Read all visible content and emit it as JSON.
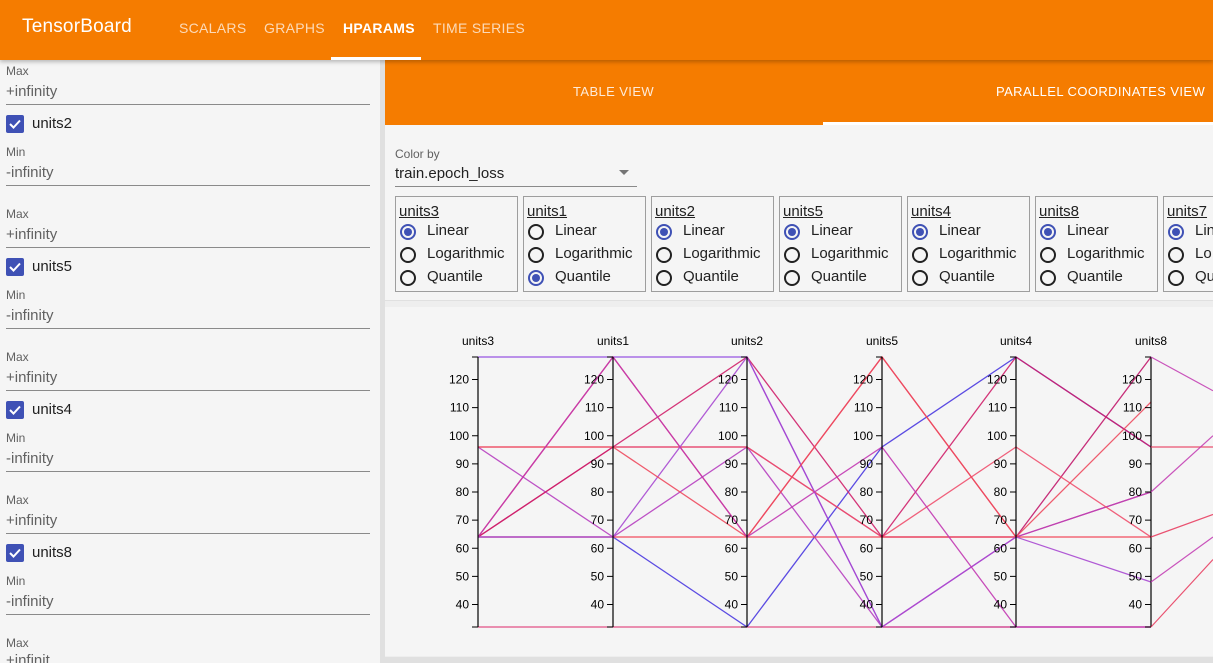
{
  "header": {
    "brand": "TensorBoard",
    "tabs": [
      {
        "label": "SCALARS",
        "active": false
      },
      {
        "label": "GRAPHS",
        "active": false
      },
      {
        "label": "HPARAMS",
        "active": true
      },
      {
        "label": "TIME SERIES",
        "active": false
      }
    ],
    "color": "#f57c00"
  },
  "sidebar": {
    "top_max": {
      "label": "Max",
      "value": "+infinity"
    },
    "filters": [
      {
        "name": "units2",
        "checked": true,
        "min_label": "Min",
        "min_value": "-infinity",
        "max_label": "Max",
        "max_value": "+infinity"
      },
      {
        "name": "units5",
        "checked": true,
        "min_label": "Min",
        "min_value": "-infinity",
        "max_label": "Max",
        "max_value": "+infinity"
      },
      {
        "name": "units4",
        "checked": true,
        "min_label": "Min",
        "min_value": "-infinity",
        "max_label": "Max",
        "max_value": "+infinity"
      },
      {
        "name": "units8",
        "checked": true,
        "min_label": "Min",
        "min_value": "-infinity",
        "max_label": "Max",
        "max_value": "+infinit"
      }
    ]
  },
  "views": {
    "table_label": "TABLE VIEW",
    "parallel_label": "PARALLEL COORDINATES VIEW",
    "active": "parallel"
  },
  "options": {
    "color_by_label": "Color by",
    "color_by_value": "train.epoch_loss",
    "scale_options": [
      "Linear",
      "Logarithmic",
      "Quantile"
    ],
    "scale_options_clipped": [
      "Lin",
      "Lo",
      "Qu"
    ],
    "scales": [
      {
        "name": "units3",
        "selected": "Linear"
      },
      {
        "name": "units1",
        "selected": "Quantile"
      },
      {
        "name": "units2",
        "selected": "Linear"
      },
      {
        "name": "units5",
        "selected": "Linear"
      },
      {
        "name": "units4",
        "selected": "Linear"
      },
      {
        "name": "units8",
        "selected": "Linear"
      },
      {
        "name": "units7",
        "selected": "Linear"
      }
    ]
  },
  "chart_data": {
    "type": "parallel_coordinates",
    "axes": [
      "units3",
      "units1",
      "units2",
      "units5",
      "units4",
      "units8"
    ],
    "ticks": [
      40,
      50,
      60,
      70,
      80,
      90,
      100,
      110,
      120
    ],
    "range": [
      32,
      128
    ],
    "lines": [
      {
        "values": [
          128,
          128,
          128,
          32,
          32,
          32
        ],
        "color": "#8e44e0"
      },
      {
        "values": [
          64,
          64,
          32,
          96,
          128,
          96
        ],
        "color": "#4a38e0"
      },
      {
        "values": [
          64,
          128,
          64,
          128,
          64,
          80
        ],
        "color": "#e8365a"
      },
      {
        "values": [
          64,
          96,
          96,
          64,
          64,
          128
        ],
        "color": "#c2186b"
      },
      {
        "values": [
          96,
          64,
          96,
          32,
          64,
          80
        ],
        "color": "#b73fc0"
      },
      {
        "values": [
          96,
          96,
          96,
          64,
          96,
          64
        ],
        "color": "#f0506e"
      },
      {
        "values": [
          64,
          96,
          128,
          64,
          128,
          96
        ],
        "color": "#d0206a"
      },
      {
        "values": [
          32,
          32,
          32,
          32,
          32,
          32
        ],
        "color": "#e0407a"
      },
      {
        "values": [
          64,
          64,
          64,
          64,
          64,
          64
        ],
        "color": "#f23a4e"
      },
      {
        "values": [
          64,
          64,
          128,
          32,
          64,
          48
        ],
        "color": "#a849d2"
      },
      {
        "values": [
          96,
          96,
          64,
          128,
          64,
          112
        ],
        "color": "#ee4a5e"
      },
      {
        "values": [
          64,
          128,
          64,
          96,
          32,
          32
        ],
        "color": "#c238b2"
      }
    ]
  }
}
